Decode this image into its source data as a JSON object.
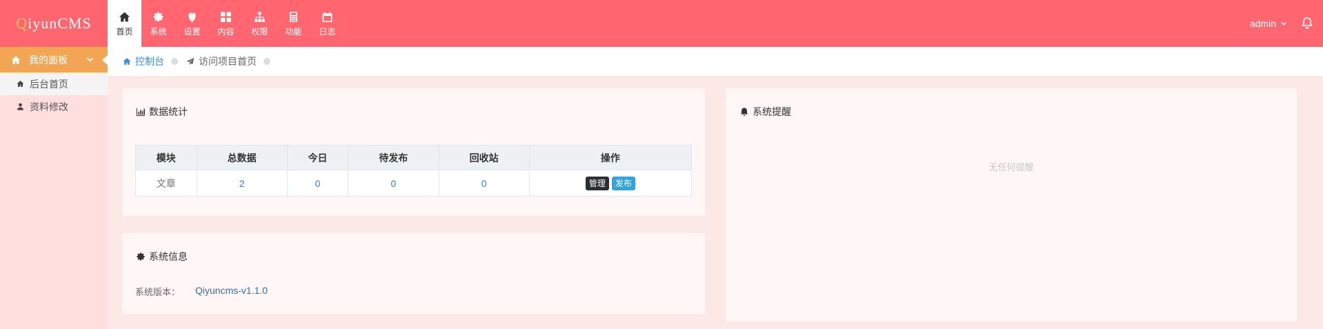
{
  "brand": {
    "q": "Q",
    "rest": "iyunCMS"
  },
  "nav": [
    {
      "label": "首页",
      "icon": "home-icon",
      "active": true
    },
    {
      "label": "系统",
      "icon": "gear-icon"
    },
    {
      "label": "设置",
      "icon": "plugin-icon"
    },
    {
      "label": "内容",
      "icon": "grid-icon"
    },
    {
      "label": "权限",
      "icon": "sitemap-icon"
    },
    {
      "label": "功能",
      "icon": "calculator-icon"
    },
    {
      "label": "日志",
      "icon": "calendar-icon"
    }
  ],
  "user": {
    "name": "admin"
  },
  "sidebar": {
    "header": "我的面板",
    "items": [
      {
        "label": "后台首页",
        "icon": "home-icon"
      },
      {
        "label": "资料修改",
        "icon": "user-icon"
      }
    ]
  },
  "breadcrumb": {
    "home": "控制台",
    "page": "访问项目首页"
  },
  "stats": {
    "title": "数据统计",
    "columns": [
      "模块",
      "总数据",
      "今日",
      "待发布",
      "回收站",
      "操作"
    ],
    "rows": [
      {
        "module": "文章",
        "total": "2",
        "today": "0",
        "pending": "0",
        "trash": "0",
        "actions": [
          "管理",
          "发布"
        ]
      }
    ]
  },
  "sysinfo": {
    "title": "系统信息",
    "version_label": "系统版本：",
    "version_value": "Qiyuncms-v1.1.0"
  },
  "alerts": {
    "title": "系统提醒",
    "empty": "无任何提醒"
  }
}
